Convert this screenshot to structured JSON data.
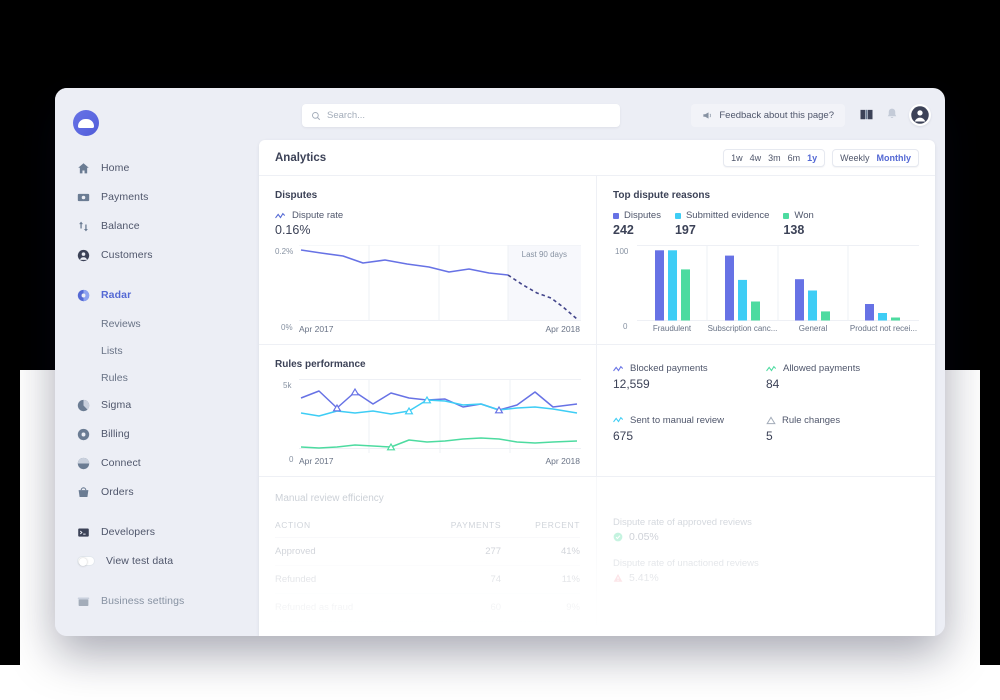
{
  "brand": {
    "accent": "#5469d4",
    "logo_icon": "stripe-cloud-logo"
  },
  "sidebar": {
    "items": [
      {
        "label": "Home",
        "icon": "home-icon",
        "active": false
      },
      {
        "label": "Payments",
        "icon": "payments-icon",
        "active": false
      },
      {
        "label": "Balance",
        "icon": "balance-arrows-icon",
        "active": false
      },
      {
        "label": "Customers",
        "icon": "customers-icon",
        "active": false
      },
      {
        "label": "Radar",
        "icon": "radar-icon",
        "active": true
      },
      {
        "label": "Sigma",
        "icon": "sigma-icon",
        "active": false
      },
      {
        "label": "Billing",
        "icon": "billing-icon",
        "active": false
      },
      {
        "label": "Connect",
        "icon": "connect-icon",
        "active": false
      },
      {
        "label": "Orders",
        "icon": "orders-icon",
        "active": false
      },
      {
        "label": "Developers",
        "icon": "developers-icon",
        "active": false
      },
      {
        "label": "View test data",
        "icon": "toggle-switch",
        "active": false
      },
      {
        "label": "Business settings",
        "icon": "business-settings-icon",
        "active": false
      }
    ],
    "subitems": [
      "Reviews",
      "Lists",
      "Rules"
    ]
  },
  "topbar": {
    "search_placeholder": "Search...",
    "search_icon": "search-icon",
    "feedback_label": "Feedback about this page?",
    "feedback_icon": "megaphone-icon",
    "docs_icon": "book-icon",
    "notifications_icon": "bell-icon",
    "avatar_icon": "user-avatar-icon"
  },
  "page": {
    "title": "Analytics",
    "range_options": [
      "1w",
      "4w",
      "3m",
      "6m",
      "1y"
    ],
    "range_selected": "1y",
    "interval_options": [
      "Weekly",
      "Monthly"
    ],
    "interval_selected": "Monthly"
  },
  "disputes_panel": {
    "title": "Disputes",
    "metric_label": "Dispute rate",
    "metric_icon": "sparkline-icon",
    "metric_value": "0.16%",
    "annotation": "Last 90 days"
  },
  "top_reasons_panel": {
    "title": "Top dispute reasons",
    "legend": [
      {
        "label": "Disputes",
        "value": "242",
        "color": "#6772e5"
      },
      {
        "label": "Submitted evidence",
        "value": "197",
        "color": "#3ecdf5"
      },
      {
        "label": "Won",
        "value": "138",
        "color": "#4ddba0"
      }
    ]
  },
  "rules_panel": {
    "title": "Rules performance"
  },
  "kpis": [
    {
      "label": "Blocked payments",
      "value": "12,559",
      "icon": "sparkline-icon",
      "color": "#6772e5"
    },
    {
      "label": "Allowed payments",
      "value": "84",
      "icon": "sparkline-icon",
      "color": "#4ddba0"
    },
    {
      "label": "Sent to manual review",
      "value": "675",
      "icon": "sparkline-icon",
      "color": "#3ecdf5"
    },
    {
      "label": "Rule changes",
      "value": "5",
      "icon": "triangle-marker-icon",
      "color": "#a3acb9"
    }
  ],
  "manual_review": {
    "title": "Manual review efficiency",
    "columns": [
      "ACTION",
      "PAYMENTS",
      "PERCENT"
    ],
    "rows": [
      {
        "action": "Approved",
        "payments": "277",
        "percent": "41%"
      },
      {
        "action": "Refunded",
        "payments": "74",
        "percent": "11%"
      },
      {
        "action": "Refunded as fraud",
        "payments": "60",
        "percent": "9%"
      }
    ]
  },
  "review_rates": [
    {
      "label": "Dispute rate of approved reviews",
      "value": "0.05%",
      "icon": "check-circle-icon",
      "color": "#4ddba0"
    },
    {
      "label": "Dispute rate of unactioned reviews",
      "value": "5.41%",
      "icon": "warning-icon",
      "color": "#ed5f74"
    }
  ],
  "chart_data": [
    {
      "type": "line",
      "title": "Disputes",
      "ylabel": "",
      "xlabel": "",
      "ylim": [
        0,
        0.2
      ],
      "ytick_labels": [
        "0.2%",
        "0%"
      ],
      "xtick_labels": [
        "Apr 2017",
        "Apr 2018"
      ],
      "grid": true,
      "legend": "none",
      "annotation": "Last 90 days",
      "series": [
        {
          "name": "Dispute rate",
          "color": "#6772e5",
          "style": "solid-then-dashed",
          "dash_from_index": 11,
          "values": [
            0.188,
            0.182,
            0.172,
            0.152,
            0.158,
            0.148,
            0.141,
            0.128,
            0.137,
            0.13,
            0.124,
            0.095,
            0.072,
            0.06,
            0.052,
            0.025,
            0.002
          ]
        }
      ]
    },
    {
      "type": "bar",
      "title": "Top dispute reasons",
      "categories": [
        "Fraudulent",
        "Subscription canc...",
        "General",
        "Product not recei..."
      ],
      "ylim": [
        0,
        100
      ],
      "ytick_labels": [
        "100",
        "0"
      ],
      "grid": true,
      "series": [
        {
          "name": "Disputes",
          "color": "#6772e5",
          "values": [
            93,
            86,
            55,
            22
          ]
        },
        {
          "name": "Submitted evidence",
          "color": "#3ecdf5",
          "values": [
            93,
            54,
            40,
            10
          ]
        },
        {
          "name": "Won",
          "color": "#4ddba0",
          "values": [
            67,
            25,
            12,
            4
          ]
        }
      ]
    },
    {
      "type": "line",
      "title": "Rules performance",
      "ylim": [
        0,
        5000
      ],
      "ytick_labels": [
        "5k",
        "0"
      ],
      "xtick_labels": [
        "Apr 2017",
        "Apr 2018"
      ],
      "grid": true,
      "series": [
        {
          "name": "Blocked payments",
          "color": "#6772e5",
          "values": [
            3650,
            4150,
            2900,
            4050,
            3250,
            4000,
            3600,
            3450,
            3550,
            2950,
            3250,
            2750,
            3100,
            4050,
            3000,
            3250
          ],
          "markers_at": [
            2,
            3,
            13
          ]
        },
        {
          "name": "Sent to manual review",
          "color": "#3ecdf5",
          "values": [
            2550,
            2300,
            2650,
            2500,
            2700,
            2450,
            2650,
            3500,
            3450,
            3150,
            3200,
            2800,
            2950,
            3000,
            2900,
            2600
          ],
          "markers_at": [
            6,
            7,
            11
          ]
        },
        {
          "name": "Allowed payments",
          "color": "#4ddba0",
          "values": [
            120,
            90,
            110,
            260,
            180,
            130,
            620,
            520,
            560,
            650,
            760,
            700,
            520,
            420,
            480,
            540
          ],
          "markers_at": [
            5
          ]
        }
      ]
    }
  ]
}
